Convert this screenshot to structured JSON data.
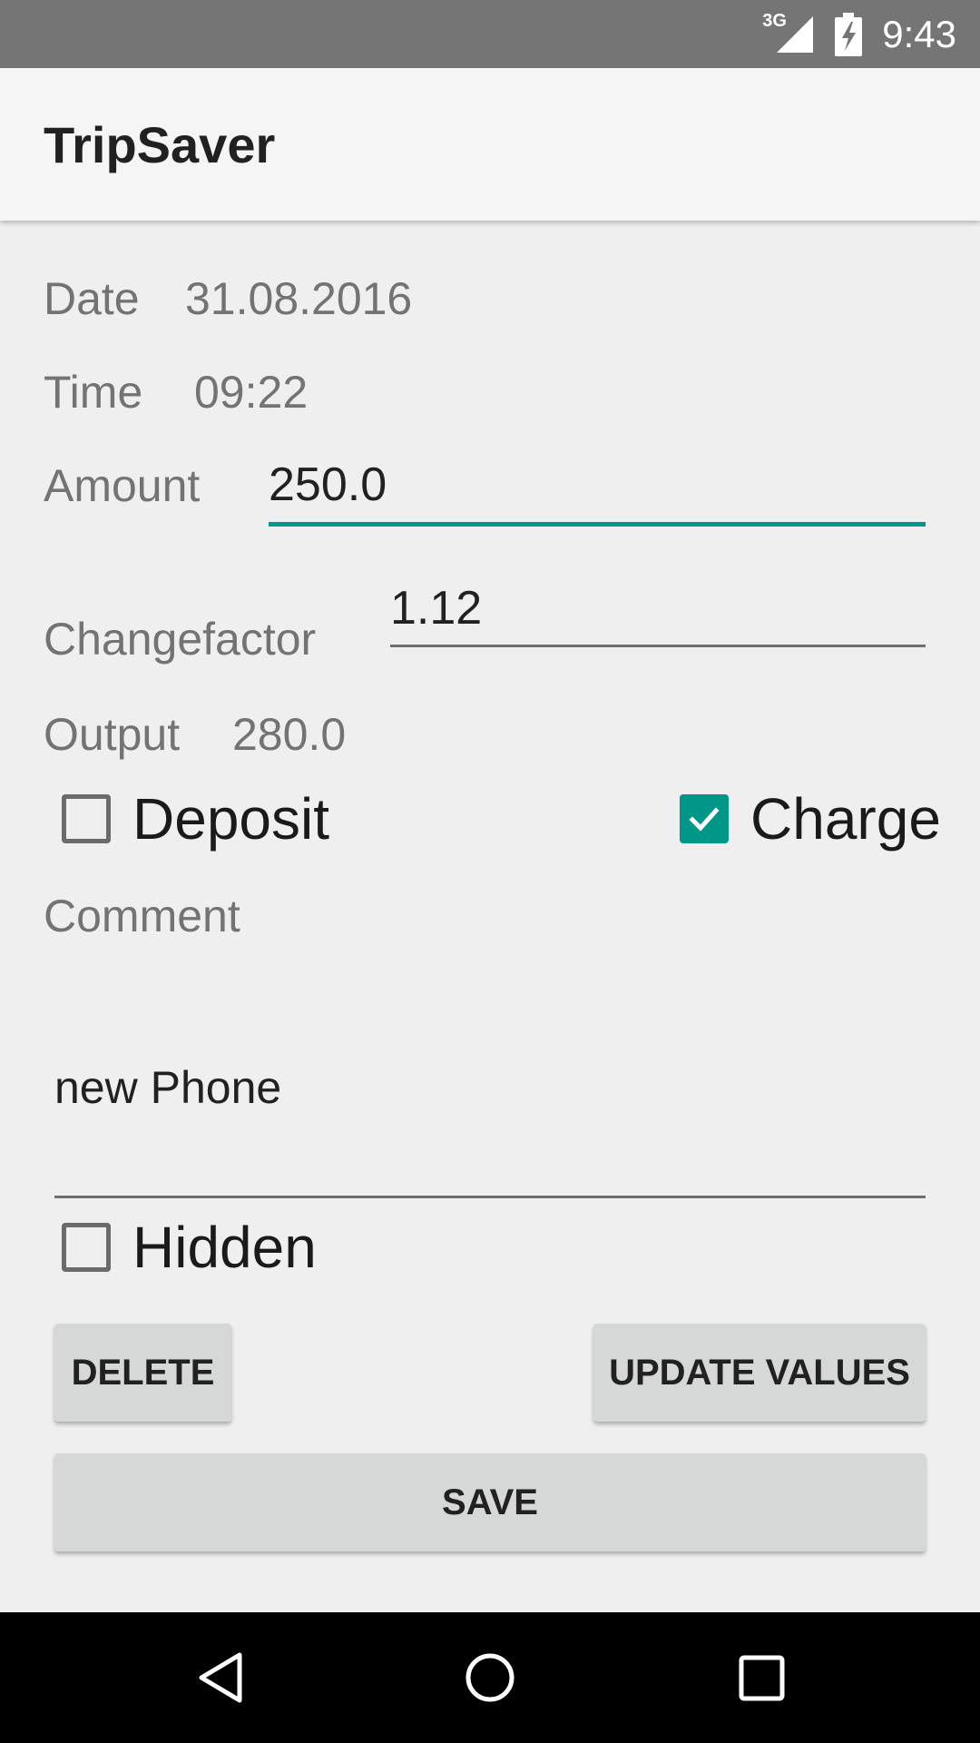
{
  "status_bar": {
    "network": "3G",
    "time": "9:43",
    "signal_icon": "signal-icon",
    "battery_icon": "battery-charging-icon"
  },
  "app_bar": {
    "title": "TripSaver"
  },
  "form": {
    "date": {
      "label": "Date",
      "value": "31.08.2016"
    },
    "time": {
      "label": "Time",
      "value": "09:22"
    },
    "amount": {
      "label": "Amount",
      "value": "250.0"
    },
    "changefactor": {
      "label": "Changefactor",
      "value": "1.12"
    },
    "output": {
      "label": "Output",
      "value": "280.0"
    },
    "deposit": {
      "label": "Deposit",
      "checked": false
    },
    "charge": {
      "label": "Charge",
      "checked": true
    },
    "comment": {
      "label": "Comment",
      "value": "new Phone"
    },
    "hidden": {
      "label": "Hidden",
      "checked": false
    }
  },
  "buttons": {
    "delete": "DELETE",
    "update": "UPDATE VALUES",
    "save": "SAVE"
  },
  "colors": {
    "accent": "#009688",
    "status_bar": "#757575",
    "app_bar": "#f5f5f5",
    "background": "#efefef",
    "button": "#d6d7d7"
  },
  "nav_bar": {
    "back": "back-icon",
    "home": "home-icon",
    "recents": "recents-icon"
  }
}
